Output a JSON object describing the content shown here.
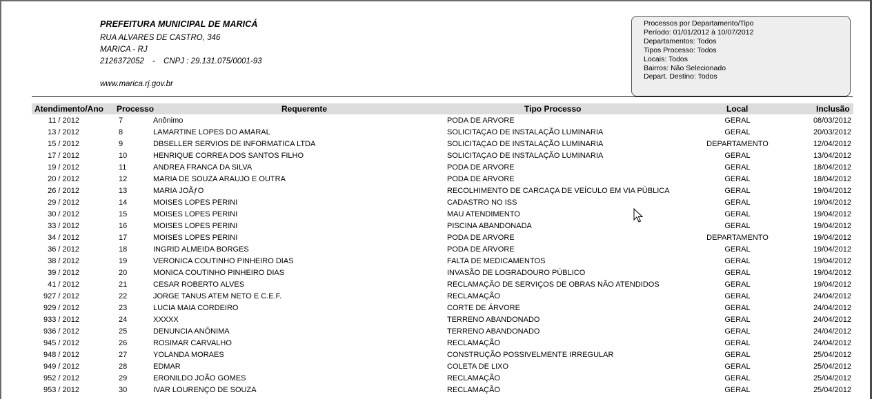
{
  "org": {
    "name": "PREFEITURA MUNICIPAL DE MARICÁ",
    "address": "RUA ALVARES DE CASTRO, 346",
    "city": "MARICA - RJ",
    "phone": "2126372052",
    "separator": "-",
    "cnpj": "CNPJ : 29.131.075/0001-93",
    "website": "www.marica.rj.gov.br"
  },
  "filters": [
    "Processos por Departamento/Tipo",
    "Período: 01/01/2012 à 10/07/2012",
    "Departamentos: Todos",
    "Tipos Processo: Todos",
    "Locais: Todos",
    "Bairros: Não Selecionado",
    "Depart. Destino: Todos"
  ],
  "columns": {
    "atendimento": "Atendimento/Ano",
    "processo": "Processo",
    "requerente": "Requerente",
    "tipo": "Tipo Processo",
    "local": "Local",
    "inclusao": "Inclusão"
  },
  "rows": [
    {
      "atendimento": "11 / 2012",
      "processo": "7",
      "requerente": "Anônimo",
      "tipo": "PODA DE ARVORE",
      "local": "GERAL",
      "inclusao": "08/03/2012"
    },
    {
      "atendimento": "13 / 2012",
      "processo": "8",
      "requerente": "LAMARTINE LOPES DO AMARAL",
      "tipo": "SOLICITAÇAO DE INSTALAÇÃO LUMINARIA",
      "local": "GERAL",
      "inclusao": "20/03/2012"
    },
    {
      "atendimento": "15 / 2012",
      "processo": "9",
      "requerente": "DBSELLER SERVIOS DE INFORMATICA LTDA",
      "tipo": "SOLICITAÇAO DE INSTALAÇÃO LUMINARIA",
      "local": "DEPARTAMENTO",
      "inclusao": "12/04/2012"
    },
    {
      "atendimento": "17 / 2012",
      "processo": "10",
      "requerente": "HENRIQUE  CORREA DOS SANTOS FILHO",
      "tipo": "SOLICITAÇAO DE INSTALAÇÃO LUMINARIA",
      "local": "GERAL",
      "inclusao": "13/04/2012"
    },
    {
      "atendimento": "19 / 2012",
      "processo": "11",
      "requerente": "ANDREA FRANCA DA SILVA",
      "tipo": "PODA DE ARVORE",
      "local": "GERAL",
      "inclusao": "18/04/2012"
    },
    {
      "atendimento": "20 / 2012",
      "processo": "12",
      "requerente": "MARIA DE SOUZA ARAUJO E OUTRA",
      "tipo": "PODA DE ARVORE",
      "local": "GERAL",
      "inclusao": "18/04/2012"
    },
    {
      "atendimento": "26 / 2012",
      "processo": "13",
      "requerente": "MARIA  JOÃƒO",
      "tipo": "RECOLHIMENTO DE CARCAÇA DE VEÍCULO EM VIA PÚBLICA",
      "local": "GERAL",
      "inclusao": "19/04/2012"
    },
    {
      "atendimento": "29 / 2012",
      "processo": "14",
      "requerente": "MOISES LOPES PERINI",
      "tipo": "CADASTRO NO ISS",
      "local": "GERAL",
      "inclusao": "19/04/2012"
    },
    {
      "atendimento": "30 / 2012",
      "processo": "15",
      "requerente": "MOISES LOPES PERINI",
      "tipo": "MAU ATENDIMENTO",
      "local": "GERAL",
      "inclusao": "19/04/2012"
    },
    {
      "atendimento": "33 / 2012",
      "processo": "16",
      "requerente": "MOISES LOPES PERINI",
      "tipo": "PISCINA ABANDONADA",
      "local": "GERAL",
      "inclusao": "19/04/2012"
    },
    {
      "atendimento": "34 / 2012",
      "processo": "17",
      "requerente": "MOISES LOPES PERINI",
      "tipo": "PODA DE ARVORE",
      "local": "DEPARTAMENTO",
      "inclusao": "19/04/2012"
    },
    {
      "atendimento": "36 / 2012",
      "processo": "18",
      "requerente": "INGRID ALMEIDA BORGES",
      "tipo": "PODA DE ARVORE",
      "local": "GERAL",
      "inclusao": "19/04/2012"
    },
    {
      "atendimento": "38 / 2012",
      "processo": "19",
      "requerente": "VERONICA COUTINHO PINHEIRO DIAS",
      "tipo": "FALTA  DE MEDICAMENTOS",
      "local": "GERAL",
      "inclusao": "19/04/2012"
    },
    {
      "atendimento": "39 / 2012",
      "processo": "20",
      "requerente": "MONICA COUTINHO PINHEIRO DIAS",
      "tipo": "INVASÃO DE LOGRADOURO PÚBLICO",
      "local": "GERAL",
      "inclusao": "19/04/2012"
    },
    {
      "atendimento": "41 / 2012",
      "processo": "21",
      "requerente": "CESAR ROBERTO ALVES",
      "tipo": "RECLAMAÇÃO DE SERVIÇOS DE OBRAS NÃO ATENDIDOS",
      "local": "GERAL",
      "inclusao": "19/04/2012"
    },
    {
      "atendimento": "927 / 2012",
      "processo": "22",
      "requerente": "JORGE TANUS ATEM NETO E C.E.F.",
      "tipo": "RECLAMAÇÃO",
      "local": "GERAL",
      "inclusao": "24/04/2012"
    },
    {
      "atendimento": "929 / 2012",
      "processo": "23",
      "requerente": "LUCIA MAIA CORDEIRO",
      "tipo": "CORTE DE ÁRVORE",
      "local": "GERAL",
      "inclusao": "24/04/2012"
    },
    {
      "atendimento": "933 / 2012",
      "processo": "24",
      "requerente": "XXXXX",
      "tipo": "TERRENO ABANDONADO",
      "local": "GERAL",
      "inclusao": "24/04/2012"
    },
    {
      "atendimento": "936 / 2012",
      "processo": "25",
      "requerente": "DENUNCIA ANÔNIMA",
      "tipo": "TERRENO ABANDONADO",
      "local": "GERAL",
      "inclusao": "24/04/2012"
    },
    {
      "atendimento": "945 / 2012",
      "processo": "26",
      "requerente": "ROSIMAR CARVALHO",
      "tipo": "RECLAMAÇÃO",
      "local": "GERAL",
      "inclusao": "24/04/2012"
    },
    {
      "atendimento": "948 / 2012",
      "processo": "27",
      "requerente": "YOLANDA MORAES",
      "tipo": "CONSTRUÇÃO POSSIVELMENTE IRREGULAR",
      "local": "GERAL",
      "inclusao": "25/04/2012"
    },
    {
      "atendimento": "949 / 2012",
      "processo": "28",
      "requerente": "EDMAR",
      "tipo": "COLETA DE LIXO",
      "local": "GERAL",
      "inclusao": "25/04/2012"
    },
    {
      "atendimento": "952 / 2012",
      "processo": "29",
      "requerente": "ERONILDO JOÃO GOMES",
      "tipo": "RECLAMAÇÃO",
      "local": "GERAL",
      "inclusao": "25/04/2012"
    },
    {
      "atendimento": "953 / 2012",
      "processo": "30",
      "requerente": "IVAR LOURENÇO DE SOUZA",
      "tipo": "RECLAMAÇÃO",
      "local": "GERAL",
      "inclusao": "25/04/2012"
    }
  ]
}
